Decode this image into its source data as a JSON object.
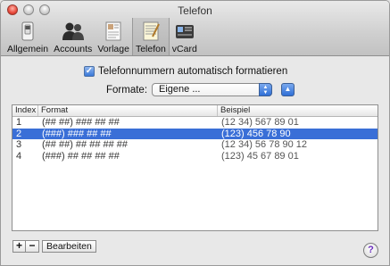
{
  "window": {
    "title": "Telefon"
  },
  "toolbar": {
    "items": [
      {
        "label": "Allgemein",
        "icon": "switch-icon"
      },
      {
        "label": "Accounts",
        "icon": "people-icon"
      },
      {
        "label": "Vorlage",
        "icon": "card-template-icon"
      },
      {
        "label": "Telefon",
        "icon": "phone-list-icon",
        "active": true
      },
      {
        "label": "vCard",
        "icon": "vcard-icon"
      }
    ]
  },
  "settings": {
    "auto_format_label": "Telefonnummern automatisch formatieren",
    "auto_format_checked": true,
    "formats_label": "Formate:",
    "formats_value": "Eigene ..."
  },
  "table": {
    "columns": [
      "Index",
      "Format",
      "Beispiel"
    ],
    "rows": [
      {
        "index": "1",
        "format": "(## ##) ### ## ##",
        "example": "(12 34) 567 89 01"
      },
      {
        "index": "2",
        "format": "(###) ### ## ##",
        "example": "(123) 456 78 90",
        "selected": true
      },
      {
        "index": "3",
        "format": "(## ##) ## ## ## ##",
        "example": "(12 34) 56 78 90 12"
      },
      {
        "index": "4",
        "format": "(###) ## ## ## ##",
        "example": "(123) 45 67 89 01"
      }
    ]
  },
  "bottom": {
    "add": "+",
    "remove": "−",
    "edit_label": "Bearbeiten",
    "help": "?"
  },
  "colors": {
    "selection": "#3a6fd7",
    "accent": "#2f6fd6"
  }
}
